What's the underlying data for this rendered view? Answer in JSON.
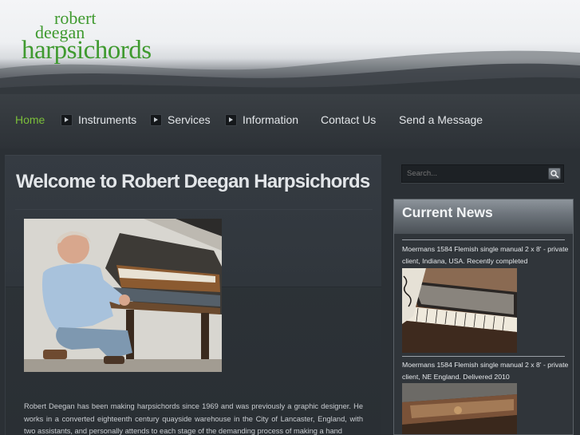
{
  "logo": {
    "line1": "robert",
    "line2": "deegan",
    "line3": "harpsichords"
  },
  "nav": {
    "home": "Home",
    "instruments": "Instruments",
    "services": "Services",
    "information": "Information",
    "contact": "Contact Us",
    "message": "Send a Message"
  },
  "main": {
    "title": "Welcome to Robert Deegan Harpsichords",
    "body": "Robert Deegan has been making harpsichords since 1969 and was previously a graphic designer. He works in a converted eighteenth century quayside warehouse in the City of Lancaster, England, with two assistants, and personally attends to each stage of the demanding process of making a hand"
  },
  "search": {
    "placeholder": "Search..."
  },
  "news": {
    "title": "Current News",
    "items": [
      {
        "text": "Moermans 1584 Flemish single manual 2 x 8' - private client, Indiana, USA. Recently completed"
      },
      {
        "text": "Moermans 1584 Flemish single manual 2 x 8' - private client, NE England. Delivered 2010"
      }
    ]
  },
  "colors": {
    "accent": "#7bbf3a",
    "logo": "#3f9a2f",
    "background": "#2b3035"
  }
}
